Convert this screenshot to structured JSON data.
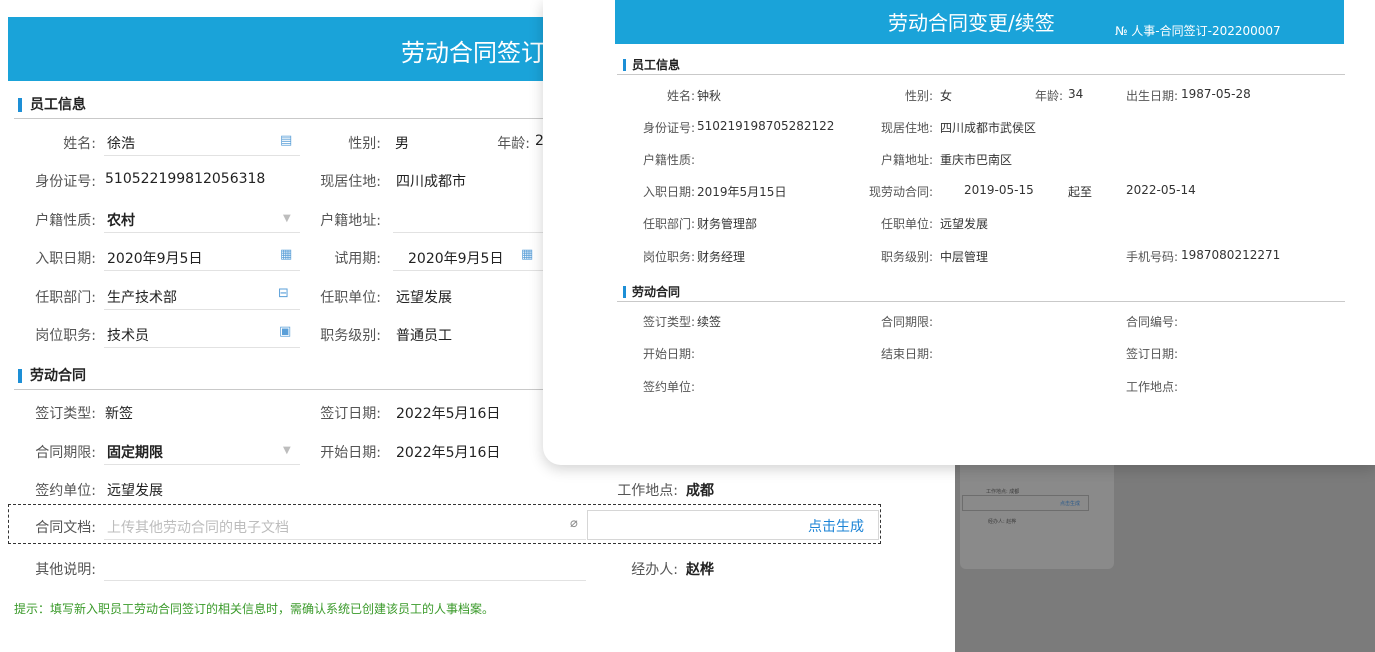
{
  "back": {
    "title": "劳动合同签订",
    "employee_section": "员工信息",
    "contract_section": "劳动合同",
    "fields": {
      "name_label": "姓名:",
      "name_value": "徐浩",
      "gender_label": "性别:",
      "gender_value": "男",
      "age_label": "年龄:",
      "age_value": "2",
      "id_label": "身份证号:",
      "id_value": "510522199812056318",
      "address_label": "现居住地:",
      "address_value": "四川成都市",
      "hukou_type_label": "户籍性质:",
      "hukou_type_value": "农村",
      "hukou_addr_label": "户籍地址:",
      "hire_date_label": "入职日期:",
      "hire_date_value": "2020年9月5日",
      "probation_label": "试用期:",
      "probation_value": "2020年9月5日",
      "dept_label": "任职部门:",
      "dept_value": "生产技术部",
      "unit_label": "任职单位:",
      "unit_value": "远望发展",
      "post_label": "岗位职务:",
      "post_value": "技术员",
      "level_label": "职务级别:",
      "level_value": "普通员工",
      "sign_type_label": "签订类型:",
      "sign_type_value": "新签",
      "sign_date_label": "签订日期:",
      "sign_date_value": "2022年5月16日",
      "term_label": "合同期限:",
      "term_value": "固定期限",
      "start_label": "开始日期:",
      "start_value": "2022年5月16日",
      "sign_unit_label": "签约单位:",
      "sign_unit_value": "远望发展",
      "work_place_label": "工作地点:",
      "work_place_value": "成都",
      "doc_label": "合同文档:",
      "doc_placeholder": "上传其他劳动合同的电子文档",
      "generate_link": "点击生成",
      "notes_label": "其他说明:",
      "handler_label": "经办人:",
      "handler_value": "赵桦"
    },
    "hint": "提示：填写新入职员工劳动合同签订的相关信息时，需确认系统已创建该员工的人事档案。"
  },
  "modal": {
    "title": "劳动合同变更/续签",
    "number": "№   人事-合同签订-202200007",
    "employee_section": "员工信息",
    "contract_section": "劳动合同",
    "fields": {
      "name_label": "姓名:",
      "name_value": "钟秋",
      "gender_label": "性别:",
      "gender_value": "女",
      "age_label": "年龄:",
      "age_value": "34",
      "birth_label": "出生日期:",
      "birth_value": "1987-05-28",
      "id_label": "身份证号:",
      "id_value": "510219198705282122",
      "address_label": "现居住地:",
      "address_value": "四川成都市武侯区",
      "hukou_type_label": "户籍性质:",
      "hukou_addr_label": "户籍地址:",
      "hukou_addr_value": "重庆市巴南区",
      "hire_label": "入职日期:",
      "hire_value": "2019年5月15日",
      "cur_contract_label": "现劳动合同:",
      "cur_contract_start": "2019-05-15",
      "range_sep": "起至",
      "cur_contract_end": "2022-05-14",
      "dept_label": "任职部门:",
      "dept_value": "财务管理部",
      "unit_label": "任职单位:",
      "unit_value": "远望发展",
      "post_label": "岗位职务:",
      "post_value": "财务经理",
      "level_label": "职务级别:",
      "level_value": "中层管理",
      "phone_label": "手机号码:",
      "phone_value": "1987080212271",
      "sign_type_label": "签订类型:",
      "sign_type_value": "续签",
      "term_label": "合同期限:",
      "contract_no_label": "合同编号:",
      "start_label": "开始日期:",
      "end_label": "结束日期:",
      "sign_date_label": "签订日期:",
      "sign_unit_label": "签约单位:",
      "work_place_label": "工作地点:"
    }
  },
  "mini": {
    "work_place": "工作地点: 成都",
    "generate": "点击生成",
    "handler": "经办人: 赵桦"
  },
  "colors": {
    "header": "#1aa3d9",
    "accent": "#1d8fd6",
    "hint": "#3a9a2a",
    "link": "#1d84d6"
  }
}
